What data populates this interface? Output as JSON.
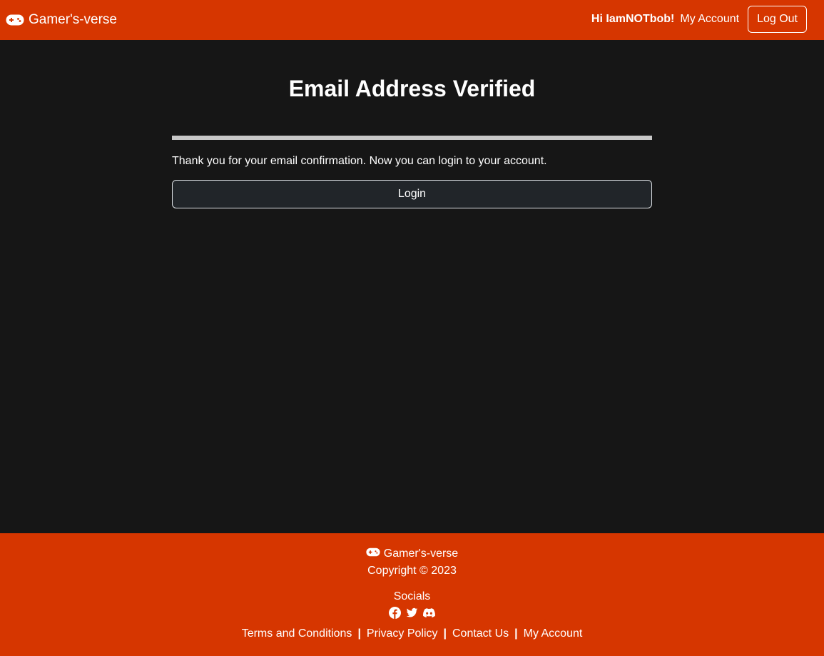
{
  "navbar": {
    "brand_icon": "gamepad-icon",
    "brand_name": "Gamer's-verse",
    "greeting": "Hi IamNOTbob!",
    "my_account": "My Account",
    "logout": "Log Out"
  },
  "main": {
    "title": "Email Address Verified",
    "message": "Thank you for your email confirmation. Now you can login to your account.",
    "login_button": "Login"
  },
  "footer": {
    "brand_icon": "gamepad-icon",
    "brand_name": "Gamer's-verse",
    "copyright": "Copyright © 2023",
    "socials_label": "Socials",
    "social_icons": [
      "facebook-icon",
      "twitter-icon",
      "discord-icon"
    ],
    "links": [
      "Terms and Conditions",
      "Privacy Policy",
      "Contact Us",
      "My Account"
    ],
    "separator": "|"
  },
  "colors": {
    "accent": "#d63600",
    "background": "#161616",
    "button_bg": "#212529",
    "divider": "#c8c8c8"
  }
}
